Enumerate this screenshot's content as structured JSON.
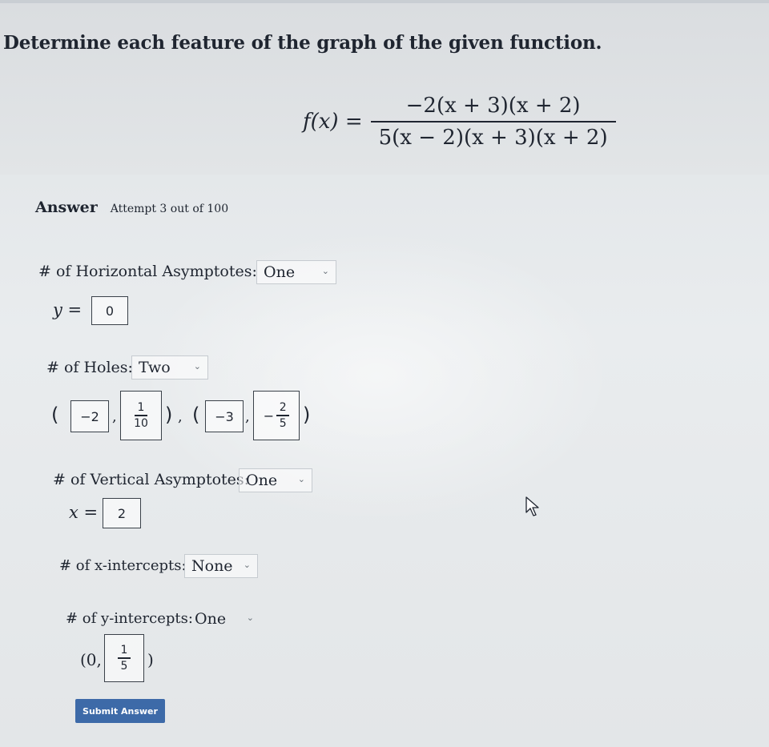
{
  "question": {
    "title": "Determine each feature of the graph of the given function.",
    "f_label": "f(x) =",
    "numerator": "−2(x + 3)(x + 2)",
    "denominator": "5(x − 2)(x + 3)(x + 2)"
  },
  "answer": {
    "label": "Answer",
    "attempt": "Attempt 3 out of 100"
  },
  "horizontal_asymptotes": {
    "label": "# of Horizontal Asymptotes:",
    "selected": "One",
    "eq_var": "y =",
    "value": "0"
  },
  "holes": {
    "label": "# of Holes:",
    "selected": "Two",
    "hole1": {
      "x": "−2",
      "y_num": "1",
      "y_den": "10"
    },
    "hole2": {
      "x": "−3",
      "y_sign": "−",
      "y_num": "2",
      "y_den": "5"
    }
  },
  "vertical_asymptotes": {
    "label": "# of Vertical Asymptotes:",
    "selected": "One",
    "eq_var": "x =",
    "value": "2"
  },
  "x_intercepts": {
    "label": "# of x-intercepts:",
    "selected": "None"
  },
  "y_intercepts": {
    "label": "# of y-intercepts:",
    "selected": "One",
    "point_prefix": "(0,",
    "y_num": "1",
    "y_den": "5",
    "point_suffix": ")"
  },
  "submit_label": "Submit Answer",
  "colors": {
    "submit": "#3d6aa8",
    "text": "#1f2530"
  }
}
